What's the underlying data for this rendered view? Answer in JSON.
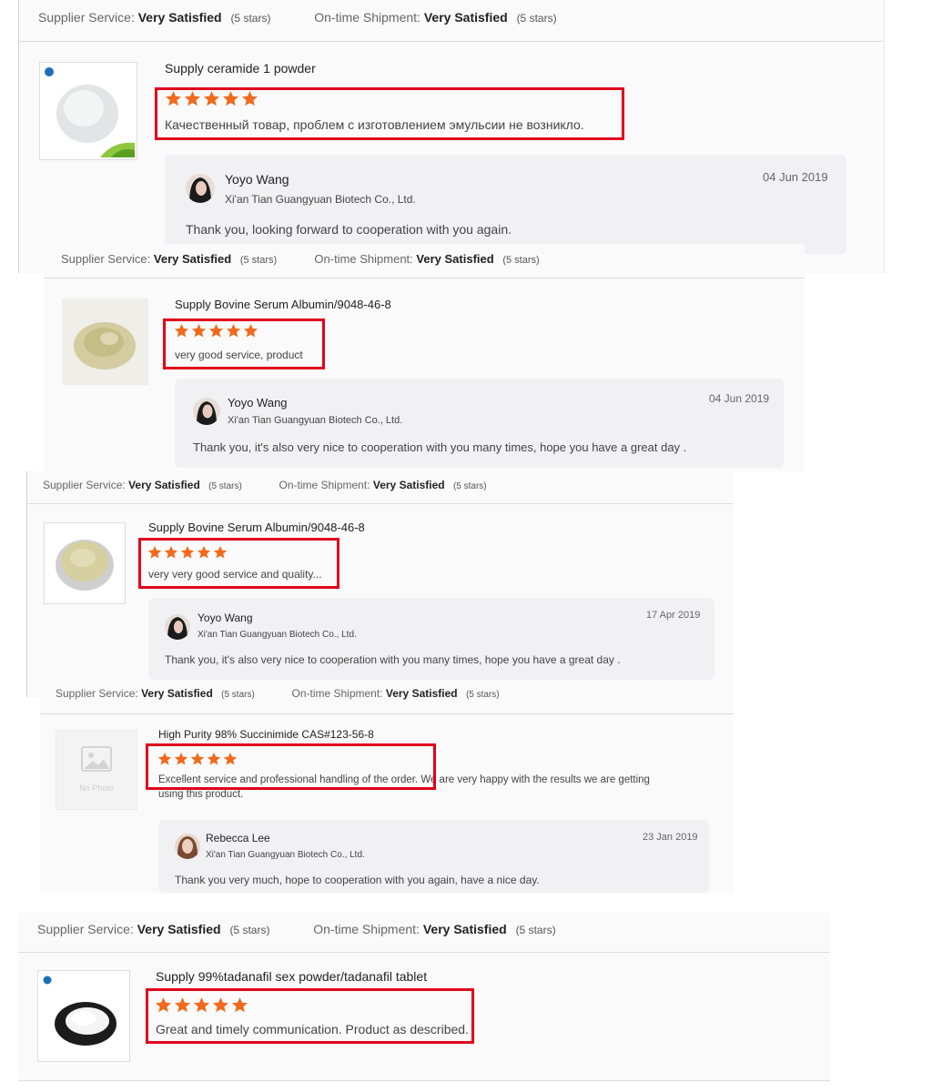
{
  "labels": {
    "supplier_service": "Supplier Service:",
    "ontime_shipment": "On-time Shipment:",
    "very_satisfied": "Very Satisfied",
    "stars_count": "(5 stars)"
  },
  "reviews": [
    {
      "product": "Supply ceramide 1 powder",
      "rating": 5,
      "comment": "Качественный товар, проблем с изготовлением эмульсии не возникло.",
      "reply": {
        "name": "Yoyo Wang",
        "company": "Xi'an Tian Guangyuan Biotech Co., Ltd.",
        "date": "04 Jun 2019",
        "text": "Thank  you, looking forward to cooperation with you again."
      }
    },
    {
      "product": "Supply Bovine Serum Albumin/9048-46-8",
      "rating": 5,
      "comment": "very good service, product",
      "reply": {
        "name": "Yoyo Wang",
        "company": "Xi'an Tian Guangyuan Biotech Co., Ltd.",
        "date": "04 Jun 2019",
        "text": "Thank you, it's also very nice to cooperation with you many times, hope you have a great day ."
      }
    },
    {
      "product": "Supply Bovine Serum Albumin/9048-46-8",
      "rating": 5,
      "comment": "very very good service and quality...",
      "reply": {
        "name": "Yoyo Wang",
        "company": "Xi'an Tian Guangyuan Biotech Co., Ltd.",
        "date": "17 Apr 2019",
        "text": "Thank you, it's also very nice to cooperation with you many times, hope you have a great day ."
      }
    },
    {
      "product": "High Purity 98% Succinimide CAS#123-56-8",
      "rating": 5,
      "comment_line1": "Excellent service and professional handling of the order. We are very happy with the results we are getting",
      "comment_line2": "using this product.",
      "no_photo": "No Photo",
      "reply": {
        "name": "Rebecca Lee",
        "company": "Xi'an Tian Guangyuan Biotech Co., Ltd.",
        "date": "23 Jan 2019",
        "text": "Thank you very much, hope to cooperation with you again, have a nice day."
      }
    },
    {
      "product": "Supply 99%tadanafil sex powder/tadanafil tablet",
      "rating": 5,
      "comment": "Great and timely communication. Product as described."
    }
  ],
  "colors": {
    "star": "#f2691b",
    "highlight_box": "#e0001b",
    "reply_bg": "#f1f1f3"
  }
}
